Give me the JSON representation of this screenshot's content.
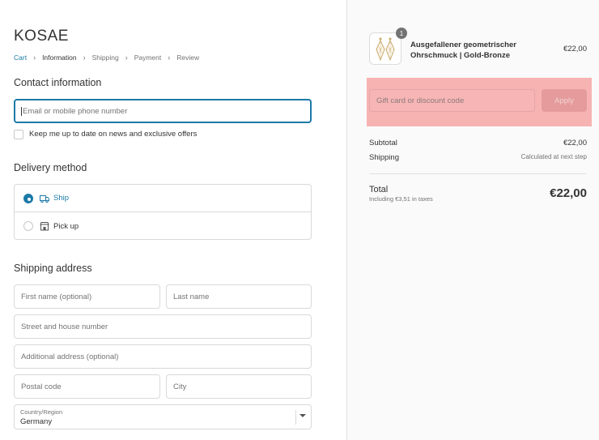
{
  "brand": "KOSAE",
  "breadcrumb": {
    "cart": "Cart",
    "information": "Information",
    "shipping": "Shipping",
    "payment": "Payment",
    "review": "Review"
  },
  "contact": {
    "title": "Contact information",
    "email_placeholder": "Email or mobile phone number",
    "newsletter_label": "Keep me up to date on news and exclusive offers"
  },
  "delivery": {
    "title": "Delivery method",
    "options": [
      {
        "label": "Ship",
        "icon": "truck-icon",
        "selected": true
      },
      {
        "label": "Pick up",
        "icon": "store-icon",
        "selected": false
      }
    ]
  },
  "shipping_address": {
    "title": "Shipping address",
    "first_name_placeholder": "First name (optional)",
    "last_name_placeholder": "Last name",
    "street_placeholder": "Street and house number",
    "additional_placeholder": "Additional address (optional)",
    "postal_placeholder": "Postal code",
    "city_placeholder": "City",
    "country_label": "Country/Region",
    "country_value": "Germany"
  },
  "order": {
    "item": {
      "name": "Ausgefallener geometrischer Ohrschmuck | Gold-Bronze",
      "price": "€22,00",
      "quantity": "1"
    },
    "discount_placeholder": "Gift card or discount code",
    "apply_label": "Apply",
    "subtotal_label": "Subtotal",
    "subtotal_value": "€22,00",
    "shipping_label": "Shipping",
    "shipping_value": "Calculated at next step",
    "total_label": "Total",
    "tax_note": "Including €3,51 in taxes",
    "total_value": "€22,00"
  },
  "colors": {
    "accent": "#1c7aa8",
    "highlight": "#f7b2b2",
    "apply_button": "#e59b9b"
  }
}
